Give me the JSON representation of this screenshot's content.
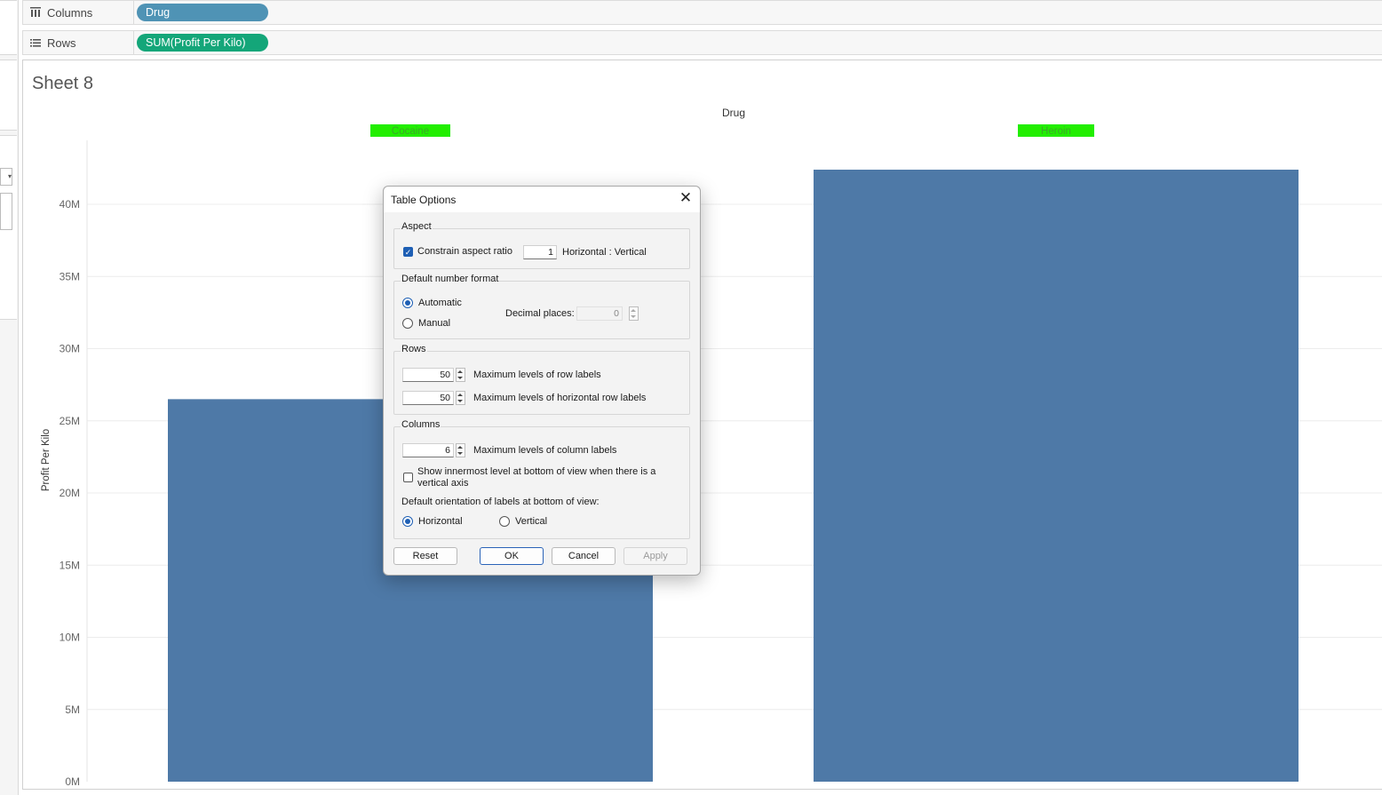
{
  "shelves": {
    "columns": {
      "label": "Columns",
      "icon": "columns-icon",
      "pill": "Drug",
      "pill_color": "#4f93b5"
    },
    "rows": {
      "label": "Rows",
      "icon": "rows-icon",
      "pill": "SUM(Profit Per Kilo)",
      "pill_color": "#14a679"
    }
  },
  "sheet": {
    "title": "Sheet 8"
  },
  "chart_data": {
    "type": "bar",
    "header_title": "Drug",
    "categories": [
      "Cocaine",
      "Heroin"
    ],
    "header_color": "#22ee00",
    "bar_color": "#4e79a7",
    "values": [
      26500000,
      42400000
    ],
    "ylabel": "Profit Per Kilo",
    "ylim": [
      0,
      44000000
    ],
    "ticks": [
      0,
      5000000,
      10000000,
      15000000,
      20000000,
      25000000,
      30000000,
      35000000,
      40000000
    ],
    "tick_labels": [
      "0M",
      "5M",
      "10M",
      "15M",
      "20M",
      "25M",
      "30M",
      "35M",
      "40M"
    ],
    "grid": true
  },
  "dialog": {
    "title": "Table Options",
    "aspect": {
      "title": "Aspect",
      "constrain_label": "Constrain aspect ratio",
      "constrain_checked": true,
      "ratio_value": "1",
      "ratio_label": "Horizontal : Vertical"
    },
    "number_format": {
      "title": "Default number format",
      "automatic_label": "Automatic",
      "manual_label": "Manual",
      "selected": "Automatic",
      "decimal_label": "Decimal places:",
      "decimal_value": "0"
    },
    "rows": {
      "title": "Rows",
      "row_labels_value": "50",
      "row_labels_label": "Maximum levels of row labels",
      "horizontal_row_labels_value": "50",
      "horizontal_row_labels_label": "Maximum levels of horizontal row labels"
    },
    "columns": {
      "title": "Columns",
      "column_labels_value": "6",
      "column_labels_label": "Maximum levels of column labels",
      "innermost_label_line1": "Show innermost level at bottom of view when there is a",
      "innermost_label_line2": "vertical axis",
      "orientation_label": "Default orientation of labels at bottom of view:",
      "horizontal_label": "Horizontal",
      "vertical_label": "Vertical",
      "orientation_selected": "Horizontal"
    },
    "buttons": {
      "reset": "Reset",
      "ok": "OK",
      "cancel": "Cancel",
      "apply": "Apply"
    }
  }
}
